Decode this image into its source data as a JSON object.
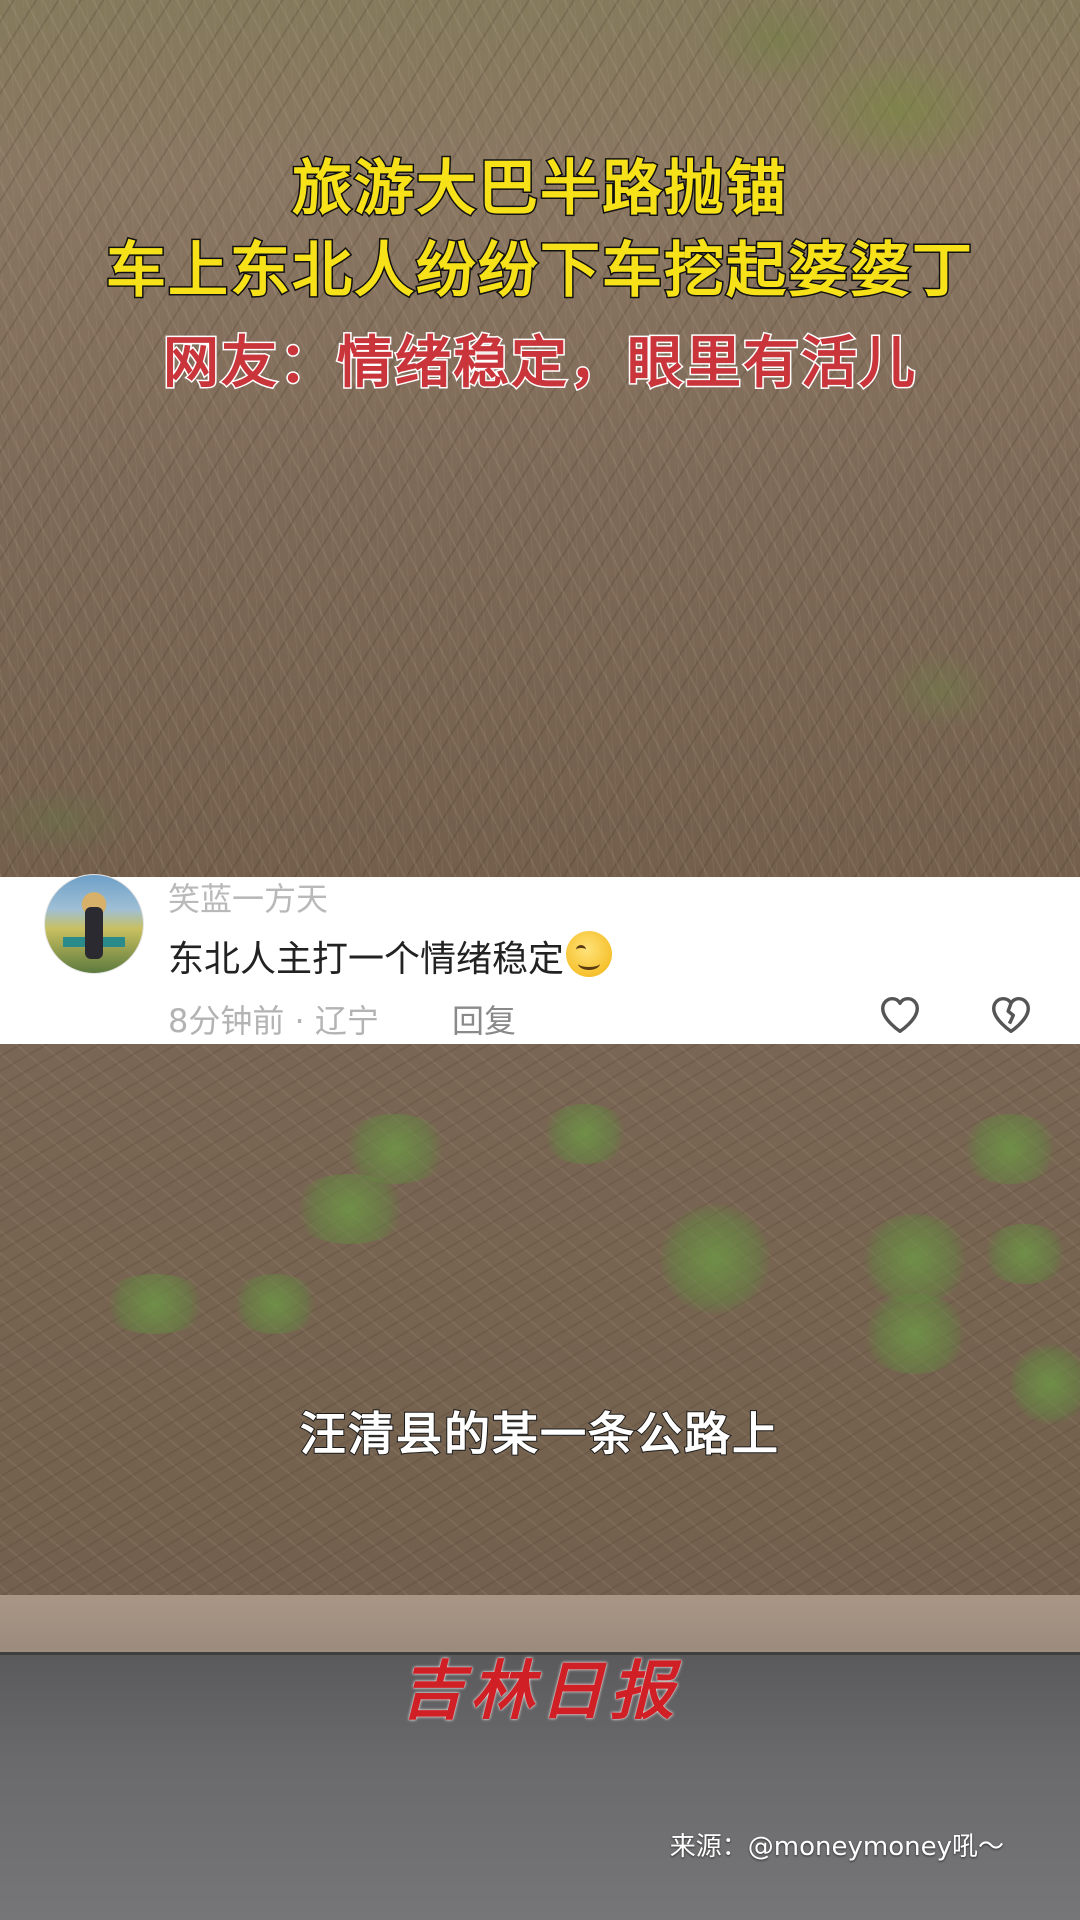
{
  "headline": {
    "line1": "旅游大巴半路抛锚",
    "line2": "车上东北人纷纷下车挖起婆婆丁",
    "line3": "网友：情绪稳定，眼里有活儿"
  },
  "comment": {
    "username": "笑蓝一方天",
    "text": "东北人主打一个情绪稳定",
    "emoji": "grinning-face-emoji",
    "time_location": "8分钟前 · 辽宁",
    "reply_label": "回复"
  },
  "subtitle": "汪清县的某一条公路上",
  "watermark": {
    "logo_text": "吉林日报",
    "source": "来源：@moneymoney吼～"
  },
  "colors": {
    "headline_yellow": "#f7e21a",
    "headline_red": "#c9353a",
    "logo_red": "#d11f26"
  }
}
